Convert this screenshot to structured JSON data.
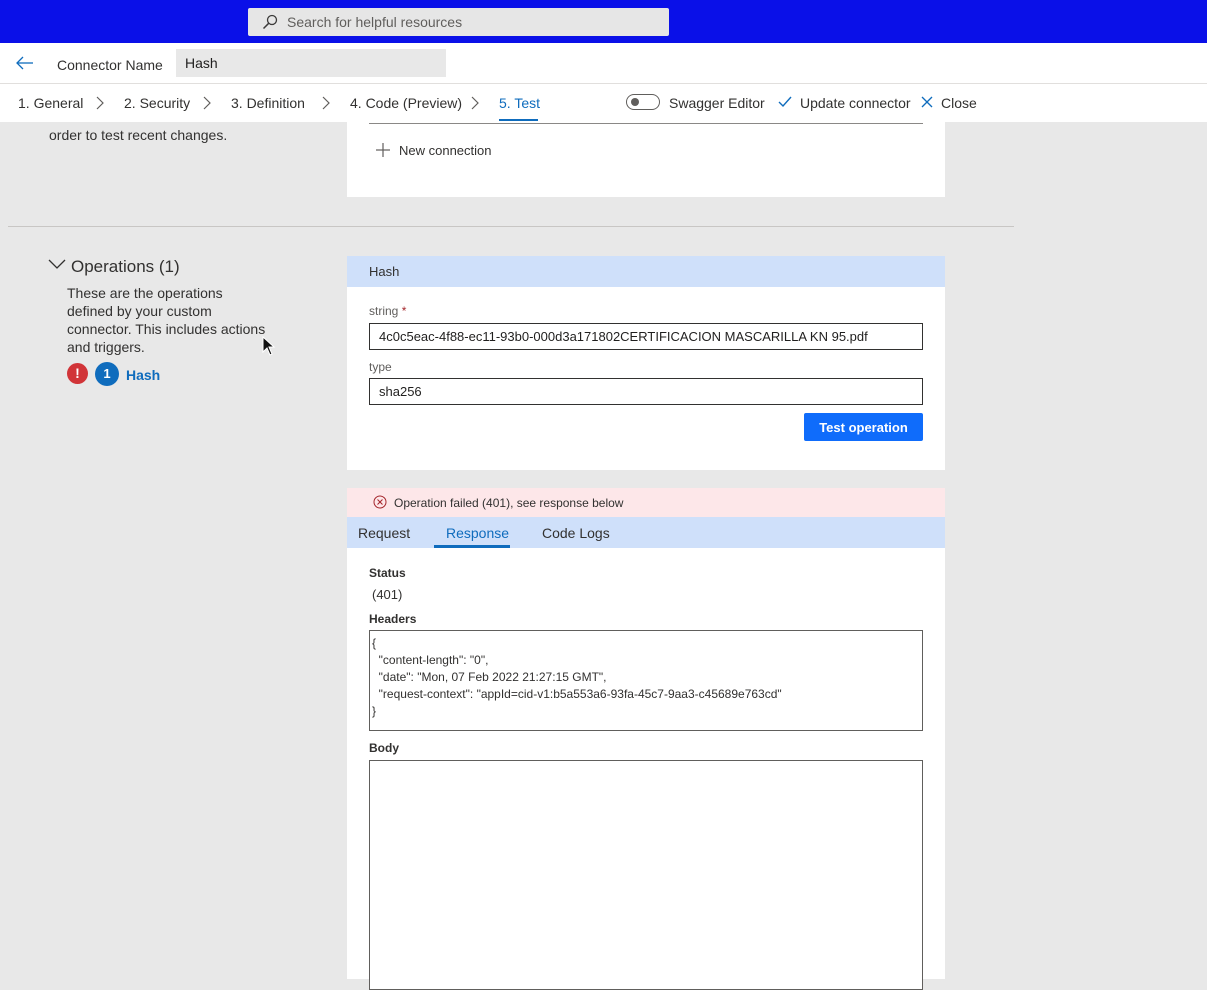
{
  "search": {
    "placeholder": "Search for helpful resources"
  },
  "connector": {
    "name_label": "Connector Name",
    "name_value": "Hash"
  },
  "steps": [
    {
      "label": "1. General"
    },
    {
      "label": "2. Security"
    },
    {
      "label": "3. Definition"
    },
    {
      "label": "4. Code (Preview)"
    },
    {
      "label": "5. Test",
      "active": true
    }
  ],
  "toolbar": {
    "swagger_label": "Swagger Editor",
    "swagger_on": false,
    "update_label": "Update connector",
    "close_label": "Close"
  },
  "connections": {
    "partial_text": "order to test recent changes.",
    "new_connection_label": "New connection"
  },
  "operations": {
    "title": "Operations (1)",
    "description": [
      "These are the operations",
      "defined by your custom",
      "connector. This includes actions",
      "and triggers."
    ],
    "error_badge": "!",
    "count_badge": "1",
    "item_label": "Hash"
  },
  "operation_form": {
    "header": "Hash",
    "fields": [
      {
        "label": "string",
        "required": "*",
        "value": "4c0c5eac-4f88-ec11-93b0-000d3a171802CERTIFICACION MASCARILLA KN 95.pdf"
      },
      {
        "label": "type",
        "value": "sha256"
      }
    ],
    "test_button": "Test operation"
  },
  "result": {
    "error_message": "Operation failed (401), see response below",
    "tabs": [
      {
        "label": "Request"
      },
      {
        "label": "Response",
        "active": true
      },
      {
        "label": "Code Logs"
      }
    ],
    "status_label": "Status",
    "status_value": "(401)",
    "headers_label": "Headers",
    "headers_lines": [
      "{",
      "  \"content-length\": \"0\",",
      "  \"date\": \"Mon, 07 Feb 2022 21:27:15 GMT\",",
      "  \"request-context\": \"appId=cid-v1:b5a553a6-93fa-45c7-9aa3-c45689e763cd\"",
      "}"
    ],
    "body_label": "Body",
    "body_value": ""
  },
  "colors": {
    "topbar": "#0a10e8",
    "accent": "#0f6cbd",
    "button": "#0f6cfb",
    "section_header": "#cfe0fa",
    "error_background": "#fde7e9",
    "error_icon": "#d13438"
  }
}
